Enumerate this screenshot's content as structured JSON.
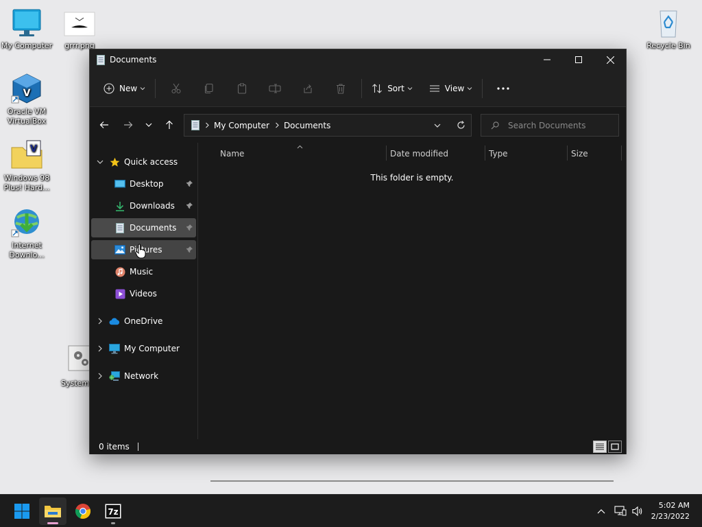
{
  "desktop": {
    "icons": [
      {
        "label": "My Computer"
      },
      {
        "label": "grrr.png"
      },
      {
        "label": "Oracle VM VirtualBox"
      },
      {
        "label": "Windows 98 Plus! Hard..."
      },
      {
        "label": "Internet Downlo..."
      },
      {
        "label": "Systemch"
      },
      {
        "label": "Recycle Bin"
      }
    ]
  },
  "window": {
    "title": "Documents",
    "toolbar": {
      "new_label": "New",
      "sort_label": "Sort",
      "view_label": "View"
    },
    "address": {
      "crumbs": [
        "My Computer",
        "Documents"
      ]
    },
    "search": {
      "placeholder": "Search Documents"
    },
    "sidebar": {
      "quick_access": "Quick access",
      "items": [
        {
          "label": "Desktop"
        },
        {
          "label": "Downloads"
        },
        {
          "label": "Documents"
        },
        {
          "label": "Pictures"
        },
        {
          "label": "Music"
        },
        {
          "label": "Videos"
        }
      ],
      "roots": [
        {
          "label": "OneDrive"
        },
        {
          "label": "My Computer"
        },
        {
          "label": "Network"
        }
      ]
    },
    "columns": {
      "name": "Name",
      "date_modified": "Date modified",
      "type": "Type",
      "size": "Size"
    },
    "empty_message": "This folder is empty.",
    "status": {
      "item_count": "0 items"
    }
  },
  "taskbar": {
    "time": "5:02 AM",
    "date": "2/23/2022",
    "apps": [
      "File Explorer",
      "Google Chrome",
      "7-Zip"
    ]
  },
  "colors": {
    "accent": "#0078d4",
    "window_bg": "#191919",
    "selection_bg": "#4a4a4a"
  }
}
